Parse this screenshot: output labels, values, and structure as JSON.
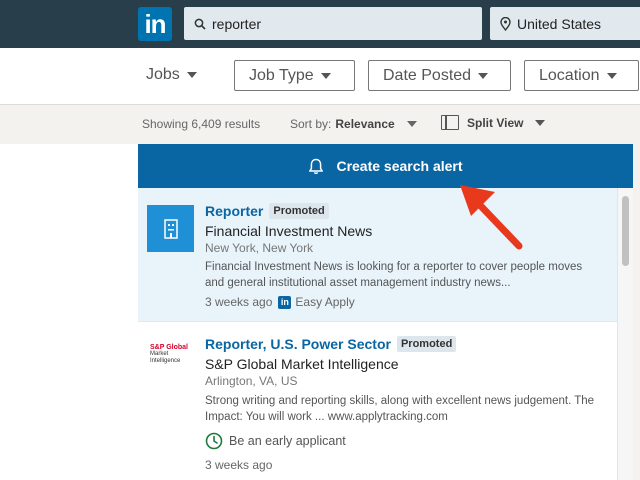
{
  "colors": {
    "topbar": "#283e4a",
    "brand": "#0073b1",
    "alert": "#0a66a2",
    "arrow": "#e8391d",
    "early_green": "#1d7a3a"
  },
  "topbar": {
    "logo": "in",
    "search_value": "reporter",
    "location_value": "United States",
    "search_icon": "search-icon",
    "location_icon": "location-pin-icon"
  },
  "filters": {
    "jobs_label": "Jobs",
    "buttons": [
      "Job Type",
      "Date Posted",
      "Location"
    ]
  },
  "results": {
    "count": "Showing 6,409 results",
    "sort_label": "Sort by:",
    "sort_value": "Relevance",
    "view_label": "Split View"
  },
  "alert": {
    "label": "Create search alert",
    "icon": "bell-icon"
  },
  "jobs": [
    {
      "title": "Reporter",
      "badge": "Promoted",
      "company": "Financial Investment News",
      "location": "New York, New York",
      "description": "Financial Investment News is looking for a reporter to cover people moves and general institutional asset management industry news...",
      "posted": "3 weeks ago",
      "apply": "Easy Apply",
      "apply_logo": "in"
    },
    {
      "title": "Reporter, U.S. Power Sector",
      "badge": "Promoted",
      "company": "S&P Global Market Intelligence",
      "location": "Arlington, VA, US",
      "description": "Strong writing and reporting skills, along with excellent news judgement. The Impact: You will work ... www.applytracking.com",
      "early": "Be an early applicant",
      "posted": "3 weeks ago",
      "logo_lines": [
        "S&P Global",
        "Market",
        "Intelligence"
      ]
    }
  ]
}
